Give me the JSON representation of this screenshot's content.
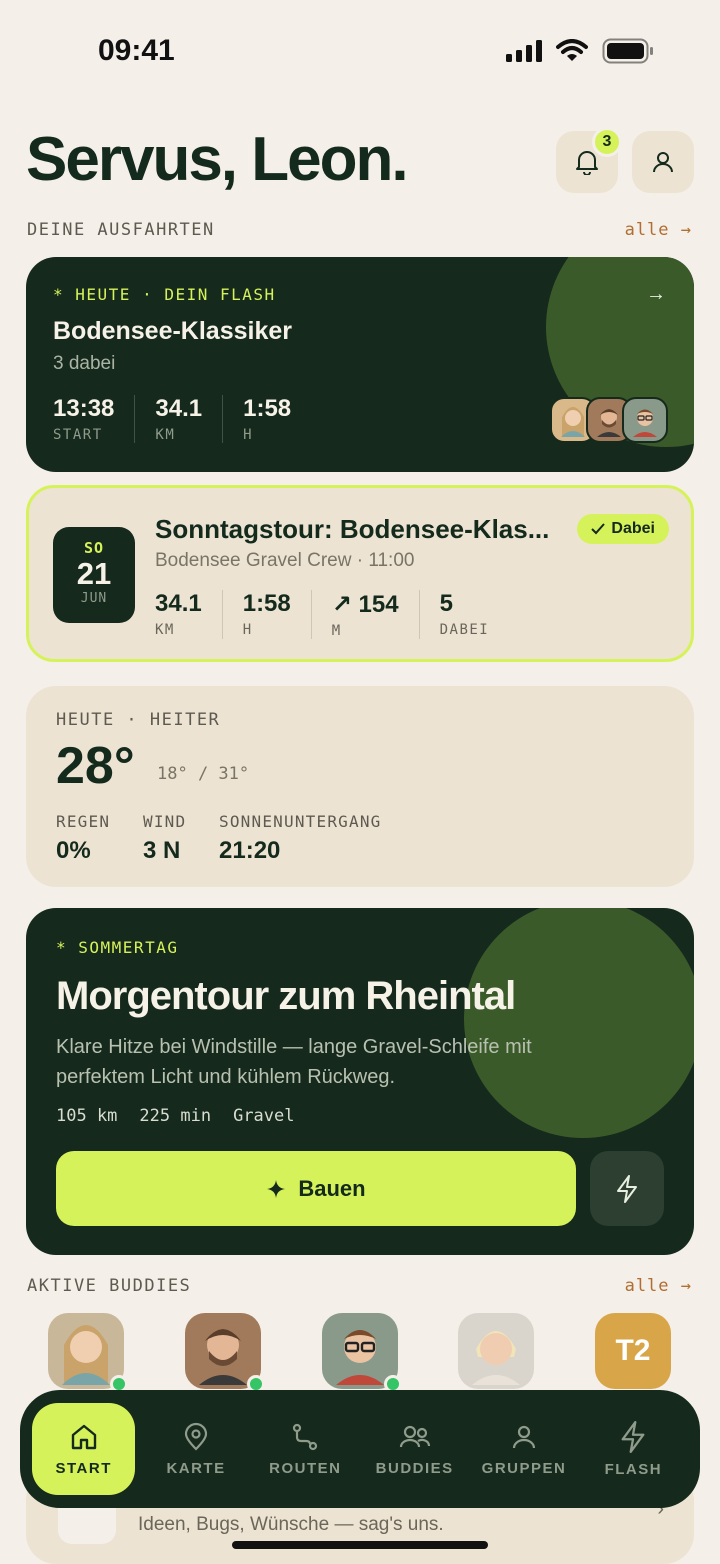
{
  "status_bar": {
    "time": "09:41"
  },
  "header": {
    "greeting": "Servus, Leon.",
    "notifications_count": "3"
  },
  "rides_section": {
    "label": "DEINE AUSFAHRTEN",
    "see_all": "alle →"
  },
  "flash_ride": {
    "kicker": "* HEUTE · DEIN FLASH",
    "title": "Bodensee-Klassiker",
    "participants": "3 dabei",
    "stats": [
      {
        "value": "13:38",
        "label": "START"
      },
      {
        "value": "34.1",
        "label": "KM"
      },
      {
        "value": "1:58",
        "label": "H"
      }
    ]
  },
  "tour": {
    "date": {
      "dow": "SO",
      "day": "21",
      "month": "JUN"
    },
    "title": "Sonntagstour: Bodensee-Klas...",
    "subtitle": "Bodensee Gravel Crew · 11:00",
    "status": "Dabei",
    "stats": [
      {
        "value": "34.1",
        "label": "KM"
      },
      {
        "value": "1:58",
        "label": "H"
      },
      {
        "value": "↗ 154",
        "label": "M"
      },
      {
        "value": "5",
        "label": "DABEI"
      }
    ]
  },
  "weather": {
    "kicker": "HEUTE · HEITER",
    "temperature": "28°",
    "range": "18° / 31°",
    "items": [
      {
        "label": "REGEN",
        "value": "0%"
      },
      {
        "label": "WIND",
        "value": "3 N"
      },
      {
        "label": "SONNENUNTERGANG",
        "value": "21:20"
      }
    ]
  },
  "suggestion": {
    "kicker": "* SOMMERTAG",
    "title": "Morgentour zum Rheintal",
    "description": "Klare Hitze bei Windstille — lange Gravel-Schleife mit perfektem Licht und kühlem Rückweg.",
    "meta": [
      "105 km",
      "225 min",
      "Gravel"
    ],
    "build_label": "Bauen"
  },
  "buddies_section": {
    "label": "AKTIVE BUDDIES",
    "see_all": "alle →",
    "last_initials": "T2"
  },
  "feedback": {
    "text": "Ideen, Bugs, Wünsche — sag's uns."
  },
  "tabs": [
    {
      "label": "START",
      "icon": "home-icon"
    },
    {
      "label": "KARTE",
      "icon": "map-pin-icon"
    },
    {
      "label": "ROUTEN",
      "icon": "route-icon"
    },
    {
      "label": "BUDDIES",
      "icon": "buddies-icon"
    },
    {
      "label": "GRUPPEN",
      "icon": "group-icon"
    },
    {
      "label": "FLASH",
      "icon": "flash-icon"
    }
  ],
  "colors": {
    "accent": "#d6f25a",
    "dark": "#15291c",
    "card": "#ece3d3",
    "background": "#f4efe8"
  }
}
